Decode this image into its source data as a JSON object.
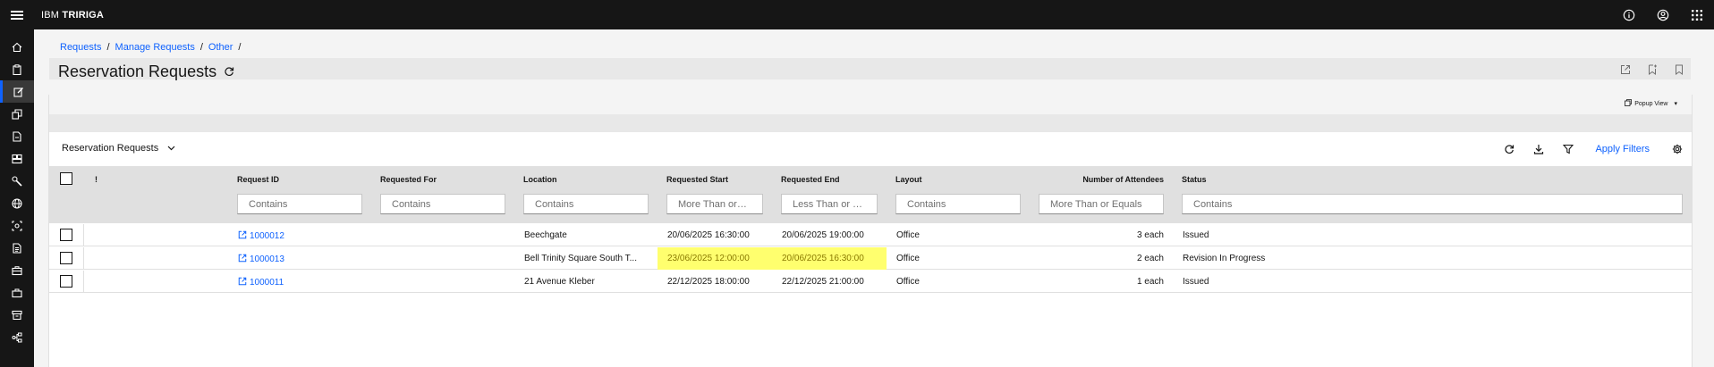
{
  "app": {
    "brand_prefix": "IBM",
    "brand_name": "TRIRIGA"
  },
  "breadcrumb": [
    "Requests",
    "Manage Requests",
    "Other"
  ],
  "breadcrumb_sep": "/",
  "page": {
    "title": "Reservation Requests"
  },
  "panel": {
    "popup_view_label": "Popup View"
  },
  "toolbar": {
    "report_name": "Reservation Requests",
    "apply_filters_label": "Apply Filters"
  },
  "table": {
    "columns": {
      "flag": "!",
      "request_id": "Request ID",
      "requested_for": "Requested For",
      "location": "Location",
      "requested_start": "Requested Start",
      "requested_end": "Requested End",
      "layout": "Layout",
      "attendees": "Number of Attendees",
      "status": "Status"
    },
    "filters": {
      "request_id": "Contains",
      "requested_for": "Contains",
      "location": "Contains",
      "requested_start": "More Than or…",
      "requested_end": "Less Than or …",
      "layout": "Contains",
      "attendees": "More Than or Equals",
      "status": "Contains"
    },
    "rows": [
      {
        "request_id": "1000012",
        "requested_for": "",
        "location": "Beechgate",
        "requested_start": "20/06/2025 16:30:00",
        "requested_end": "20/06/2025 19:00:00",
        "layout": "Office",
        "attendees": "3 each",
        "status": "Issued"
      },
      {
        "request_id": "1000013",
        "requested_for": "",
        "location": "Bell Trinity Square South T...",
        "requested_start": "23/06/2025 12:00:00",
        "requested_end": "20/06/2025 16:30:00",
        "layout": "Office",
        "attendees": "2 each",
        "status": "Revision In Progress"
      },
      {
        "request_id": "1000011",
        "requested_for": "",
        "location": "21 Avenue Kleber",
        "requested_start": "22/12/2025 18:00:00",
        "requested_end": "22/12/2025 21:00:00",
        "layout": "Office",
        "attendees": "1 each",
        "status": "Issued"
      }
    ]
  },
  "colors": {
    "accent": "#0f62fe",
    "highlight": "#ffff6e",
    "topbar": "#161616"
  },
  "icons": {
    "topbar": [
      "info-icon",
      "user-avatar-icon",
      "app-switcher-icon"
    ],
    "rail": [
      "home-icon",
      "clipboard-icon",
      "edit-icon",
      "copy-icon",
      "document-icon",
      "dashboard-icon",
      "wrench-icon",
      "globe-icon",
      "location-icon",
      "report-icon",
      "briefcase-icon",
      "portfolio-icon",
      "archive-icon",
      "flow-icon"
    ],
    "header": [
      "launch-icon",
      "bookmark-add-icon",
      "bookmark-icon"
    ],
    "toolbar": [
      "refresh-icon",
      "download-icon",
      "filter-icon",
      "settings-icon"
    ]
  }
}
